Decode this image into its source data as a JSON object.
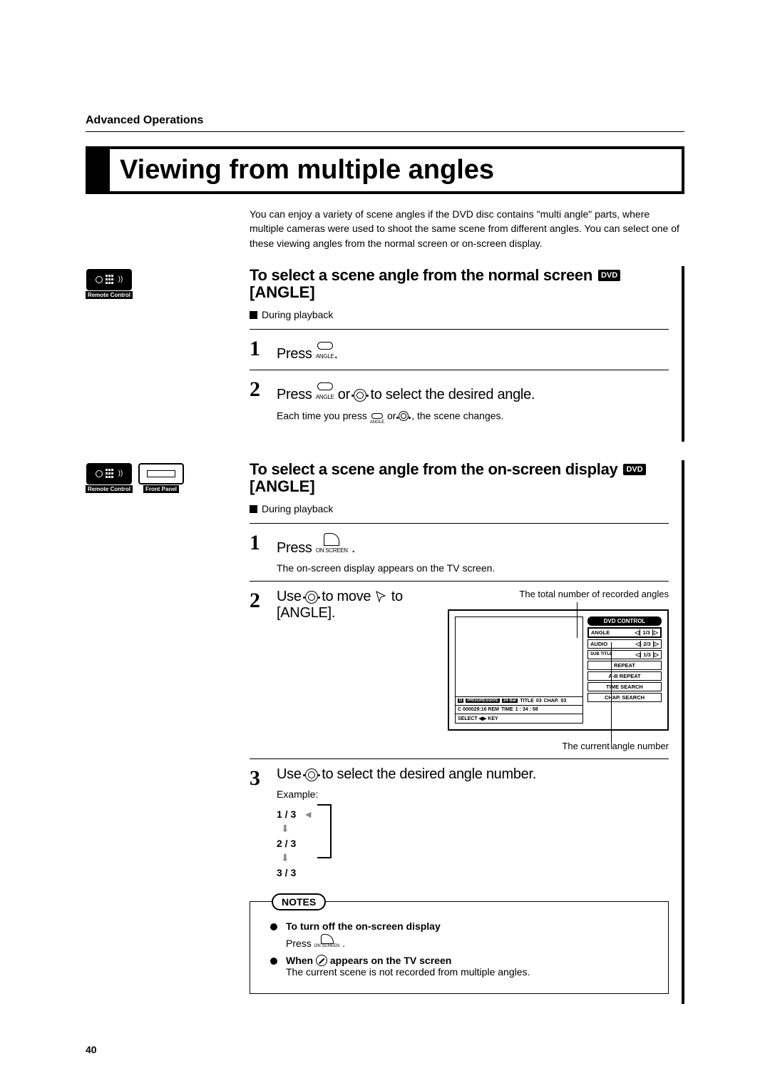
{
  "header": {
    "section": "Advanced Operations"
  },
  "title": "Viewing from multiple angles",
  "intro": "You can enjoy a variety of scene angles if the DVD disc contains \"multi angle\" parts, where multiple cameras were used to shoot the same scene from different angles.  You can select one of these viewing angles from the normal screen or on-screen display.",
  "icons": {
    "remote_label": "Remote Control",
    "front_label": "Front Panel"
  },
  "section1": {
    "heading": "To select a scene angle from the normal screen",
    "sub": "[ANGLE]",
    "badge": "DVD",
    "during": "During playback",
    "step1": {
      "num": "1",
      "text": "Press ",
      "btn_label": "ANGLE"
    },
    "step2": {
      "num": "2",
      "text_a": "Press ",
      "text_or": " or ",
      "text_b": " to select the desired angle.",
      "sub_a": "Each time you press ",
      "sub_or": " or ",
      "sub_b": ", the scene changes.",
      "btn_label": "ANGLE"
    }
  },
  "section2": {
    "heading": "To select a scene angle from the on-screen display",
    "sub": "[ANGLE]",
    "badge": "DVD",
    "during": "During playback",
    "step1": {
      "num": "1",
      "text": "Press ",
      "btn_label": "ON SCREEN",
      "sub": "The on-screen display appears on the TV screen."
    },
    "step2": {
      "num": "2",
      "text_a": "Use ",
      "text_b": " to move ",
      "text_c": " to [ANGLE].",
      "caption_top": "The total number of recorded angles",
      "caption_bottom": "The current angle number"
    },
    "step3": {
      "num": "3",
      "text_a": "Use ",
      "text_b": " to select the desired angle number.",
      "example_label": "Example:",
      "ex1": "1 / 3",
      "ex2": "2 / 3",
      "ex3": "3 / 3"
    }
  },
  "osd": {
    "dvd_control": "DVD CONTROL",
    "angle": "ANGLE",
    "angle_val": "1/3",
    "audio": "AUDIO",
    "audio_val": "2/3",
    "subtitle": "SUB TITLE",
    "subtitle_val": "1/3",
    "repeat": "REPEAT",
    "ab_repeat": "A-B REPEAT",
    "time_search": "TIME SEARCH",
    "chap_search": "CHAP. SEARCH",
    "row_title": "TITLE",
    "row_title_val": "03",
    "row_chap": "CHAP.",
    "row_chap_val": "03",
    "row_time": "TIME",
    "row_time_val": "1 : 34 : 58",
    "row_chunk": "C 000029:16 REM",
    "row_select": "SELECT ◀▶ KEY"
  },
  "notes": {
    "label": "NOTES",
    "n1_bold": "To turn off the on-screen display",
    "n1_text": "Press ",
    "n1_btn": "ON SCREEN",
    "n2_bold_a": "When ",
    "n2_bold_b": " appears on the TV screen",
    "n2_text": "The current scene is not recorded from multiple angles."
  },
  "page_number": "40"
}
